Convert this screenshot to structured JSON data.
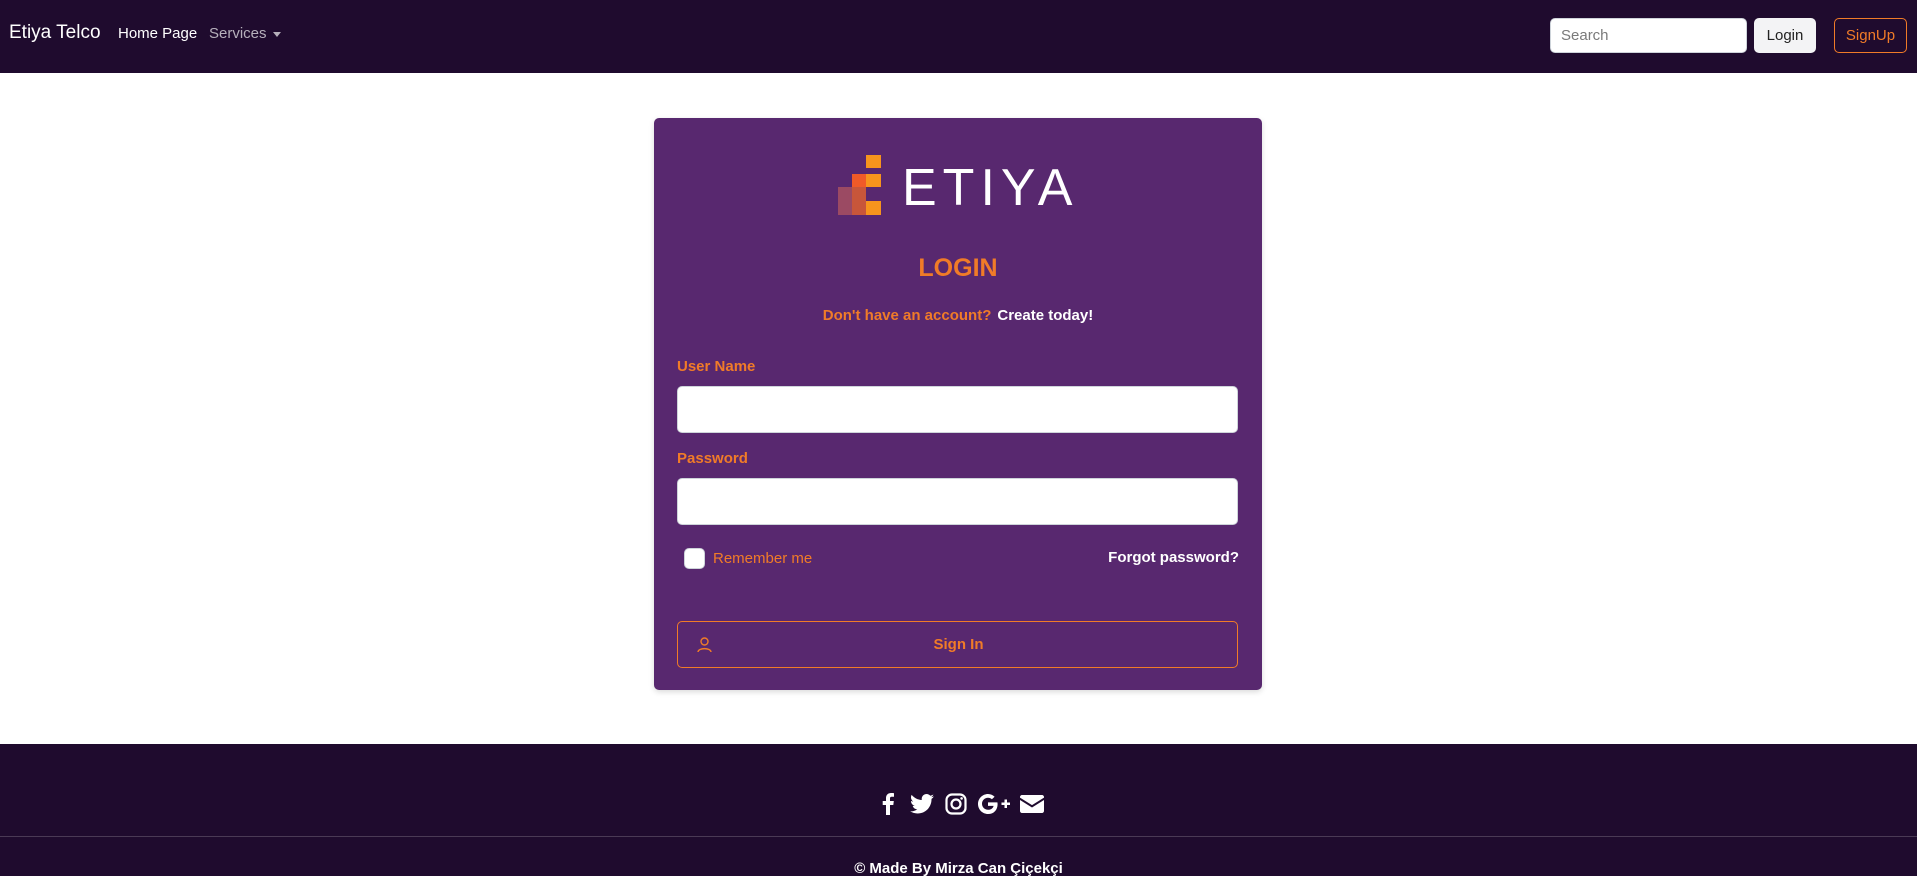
{
  "navbar": {
    "brand": "Etiya Telco",
    "home_link": "Home Page",
    "services_link": "Services",
    "search_placeholder": "Search",
    "login_button": "Login",
    "signup_button": "SignUp"
  },
  "card": {
    "logo_text": "ETIYA",
    "title": "LOGIN",
    "account_question": "Don't have an account?",
    "create_link": "Create today!",
    "username_label": "User Name",
    "username_value": "",
    "password_label": "Password",
    "password_value": "",
    "remember_label": "Remember me",
    "remember_checked": false,
    "forgot_link": "Forgot password?",
    "signin_button": "Sign In"
  },
  "footer": {
    "social_icons": [
      "facebook-icon",
      "twitter-icon",
      "instagram-icon",
      "google-plus-icon",
      "envelope-icon"
    ],
    "copyright": "© Made By Mirza Can Çiçekçi"
  },
  "colors": {
    "nav_bg": "#1f0b2e",
    "card_bg": "#58286f",
    "accent": "#f07b28",
    "footer_bg": "#1f0b2e"
  }
}
